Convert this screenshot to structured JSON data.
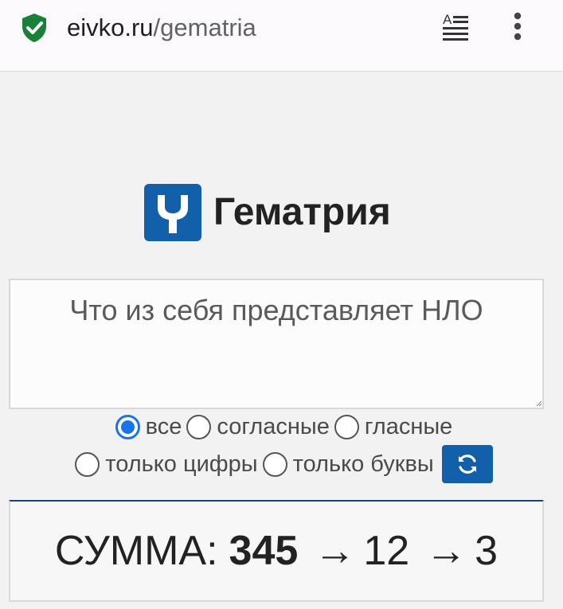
{
  "browser": {
    "url_domain": "eivko.ru",
    "url_path": "/gematria",
    "security_icon": "shield-check-icon",
    "reader_icon": "reader-mode-icon",
    "menu_icon": "more-vert-icon"
  },
  "header": {
    "title": "Гематрия",
    "logo_icon": "gematria-logo-icon"
  },
  "input": {
    "value": "Что из себя представляет НЛО"
  },
  "options": {
    "all": "все",
    "consonants": "согласные",
    "vowels": "гласные",
    "digits_only": "только цифры",
    "letters_only": "только буквы",
    "selected": "все",
    "refresh_icon": "refresh-icon"
  },
  "result": {
    "label": "СУММА:",
    "sum": "345",
    "arrow": "→",
    "reduced1": "12",
    "reduced2": "3"
  },
  "colors": {
    "accent": "#1260a9",
    "radio_checked": "#1a73e8",
    "security_green": "#188038"
  }
}
